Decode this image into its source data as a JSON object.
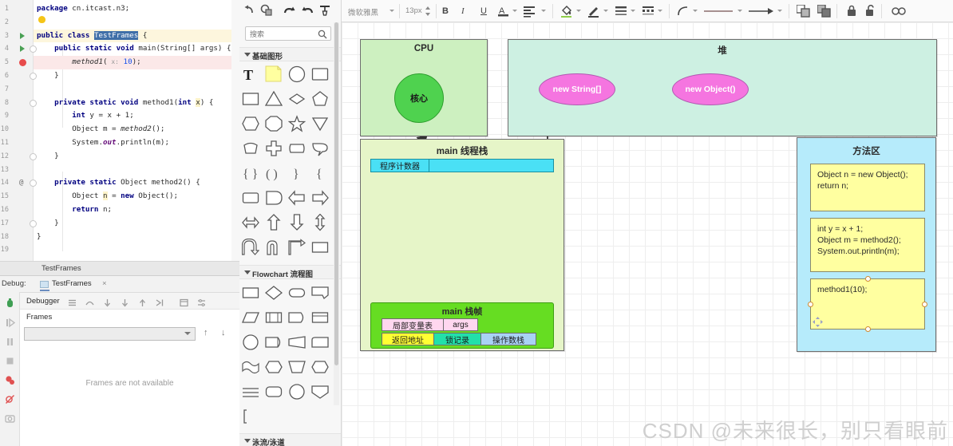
{
  "ide": {
    "editor": {
      "lines": [
        {
          "n": "1",
          "marker": "",
          "fold": false
        },
        {
          "n": "2",
          "marker": "bulb",
          "fold": false
        },
        {
          "n": "3",
          "marker": "run",
          "fold": false
        },
        {
          "n": "4",
          "marker": "run",
          "fold": true
        },
        {
          "n": "5",
          "marker": "breakpoint",
          "fold": false
        },
        {
          "n": "6",
          "marker": "",
          "fold": true
        },
        {
          "n": "7",
          "marker": "",
          "fold": false
        },
        {
          "n": "8",
          "marker": "",
          "fold": true
        },
        {
          "n": "9",
          "marker": "",
          "fold": false
        },
        {
          "n": "10",
          "marker": "",
          "fold": false
        },
        {
          "n": "11",
          "marker": "",
          "fold": false
        },
        {
          "n": "12",
          "marker": "",
          "fold": true
        },
        {
          "n": "13",
          "marker": "",
          "fold": false
        },
        {
          "n": "14",
          "marker": "at",
          "fold": true
        },
        {
          "n": "15",
          "marker": "",
          "fold": false
        },
        {
          "n": "16",
          "marker": "",
          "fold": false
        },
        {
          "n": "17",
          "marker": "",
          "fold": true
        },
        {
          "n": "18",
          "marker": "",
          "fold": false
        },
        {
          "n": "19",
          "marker": "",
          "fold": false
        }
      ],
      "code": [
        "package cn.itcast.n3;",
        "",
        "public class TestFrames {",
        "    public static void main(String[] args) {",
        "        method1( x: 10);",
        "    }",
        "",
        "    private static void method1(int x) {",
        "        int y = x + 1;",
        "        Object m = method2();",
        "        System.out.println(m);",
        "    }",
        "",
        "    private static Object method2() {",
        "        Object n = new Object();",
        "        return n;",
        "    }",
        "}",
        ""
      ]
    },
    "tab_label": "TestFrames",
    "debug": {
      "label": "Debug:",
      "session_name": "TestFrames",
      "close_glyph": "×",
      "toolbar_label": "Debugger",
      "frames_tab": "Frames",
      "frames_empty": "Frames are not available",
      "frame_selector_value": ""
    }
  },
  "shapes_panel": {
    "search_placeholder": "搜索",
    "sections": [
      {
        "title": "基础图形"
      },
      {
        "title": "Flowchart 流程图"
      },
      {
        "title": "泳流/泳道"
      }
    ]
  },
  "toolbar": {
    "font_name": "微软雅黑",
    "font_size": "13px",
    "bold": "B",
    "italic": "I",
    "underline": "U",
    "font_color": "A"
  },
  "diagram": {
    "cpu": {
      "title": "CPU",
      "core_label": "核心",
      "fill": "#cdf0c0",
      "core_fill": "#4fd24f"
    },
    "heap": {
      "title": "堆",
      "fill": "#cdf0e2",
      "objects": [
        {
          "label": "new String[]",
          "fill": "#f575e0"
        },
        {
          "label": "new Object()",
          "fill": "#f575e0"
        }
      ]
    },
    "thread_stack": {
      "title": "main 线程栈",
      "fill": "#e6f5c8",
      "pc_label": "程序计数器",
      "pc_fill": "#4ae0f5",
      "frame": {
        "title": "main 栈帧",
        "fill": "#66dd22",
        "cells_row1": [
          {
            "label": "局部变量表",
            "fill": "#ffd7ef"
          },
          {
            "label": "args",
            "fill": "#ffd7ef"
          }
        ],
        "cells_row2": [
          {
            "label": "返回地址",
            "fill": "#ffff33"
          },
          {
            "label": "锁记录",
            "fill": "#22e0aa"
          },
          {
            "label": "操作数栈",
            "fill": "#a9d2f5"
          }
        ]
      }
    },
    "method_area": {
      "title": "方法区",
      "fill": "#b6ebfb",
      "cards": [
        {
          "text": "Object n = new Object();\nreturn n;",
          "selected": false
        },
        {
          "text": "int y = x + 1;\nObject m = method2();\nSystem.out.println(m);",
          "selected": false
        },
        {
          "text": "method1(10);",
          "selected": true
        }
      ]
    }
  },
  "watermark": "CSDN @未来很长，别只看眼前"
}
